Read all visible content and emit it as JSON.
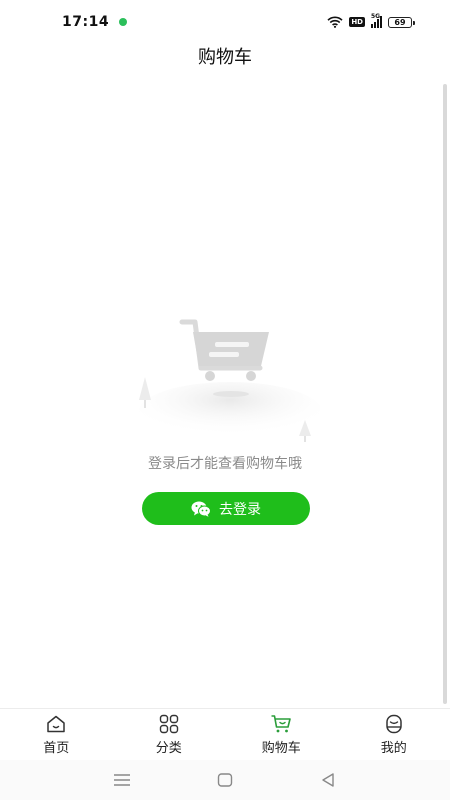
{
  "status_bar": {
    "time": "17:14",
    "network": "5G",
    "hd_label": "HD",
    "battery": "69"
  },
  "header": {
    "title": "购物车"
  },
  "empty_state": {
    "message": "登录后才能查看购物车哦",
    "login_button": "去登录"
  },
  "tab_bar": {
    "items": [
      {
        "label": "首页",
        "icon": "home-icon"
      },
      {
        "label": "分类",
        "icon": "category-icon"
      },
      {
        "label": "购物车",
        "icon": "cart-icon",
        "active": true
      },
      {
        "label": "我的",
        "icon": "profile-icon"
      }
    ]
  },
  "colors": {
    "accent": "#1fbe1b",
    "active_tab_icon": "#2a9d3a",
    "placeholder_text": "#8a8a8a",
    "notification": "#2bbf5b"
  }
}
